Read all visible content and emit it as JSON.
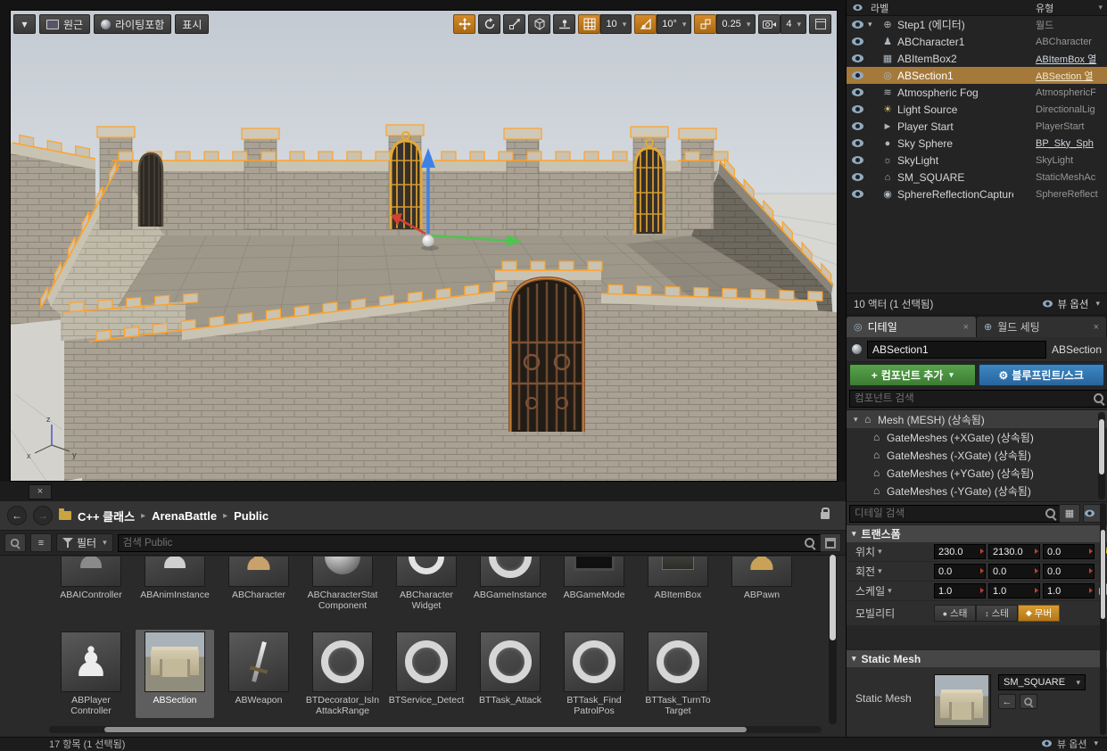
{
  "viewport": {
    "toolbar": {
      "options_arrow": "▾",
      "perspective": "원근",
      "lit": "라이팅포함",
      "show": "표시",
      "grid_snap_value": "10",
      "rotation_snap_value": "10°",
      "scale_snap_value": "0.25",
      "camera_speed_value": "4"
    },
    "axis_labels": {
      "x": "x",
      "y": "y",
      "z": "z"
    },
    "close_tab": "×"
  },
  "outliner": {
    "columns": {
      "label": "라벨",
      "type": "유형"
    },
    "rows": [
      {
        "icon": "world",
        "label": "Step1 (에디터)",
        "type": "월드",
        "expand": true
      },
      {
        "icon": "character",
        "label": "ABCharacter1",
        "type": "ABCharacter"
      },
      {
        "icon": "box",
        "label": "ABItemBox2",
        "type": "ABItemBox 열",
        "type_link": true
      },
      {
        "icon": "section",
        "label": "ABSection1",
        "type": "ABSection 열",
        "selected": true,
        "type_link": true
      },
      {
        "icon": "fog",
        "label": "Atmospheric Fog",
        "type": "AtmosphericF"
      },
      {
        "icon": "light",
        "label": "Light Source",
        "type": "DirectionalLig"
      },
      {
        "icon": "player",
        "label": "Player Start",
        "type": "PlayerStart"
      },
      {
        "icon": "sphere",
        "label": "Sky Sphere",
        "type": "BP_Sky_Sph",
        "type_link": true
      },
      {
        "icon": "skylight",
        "label": "SkyLight",
        "type": "SkyLight"
      },
      {
        "icon": "house",
        "label": "SM_SQUARE",
        "type": "StaticMeshAc"
      },
      {
        "icon": "capture",
        "label": "SphereReflectionCapture",
        "type": "SphereReflect"
      }
    ],
    "footer": {
      "status": "10 액터 (1 선택됨)",
      "view_options": "뷰 옵션"
    }
  },
  "details": {
    "tabs": [
      {
        "label": "디테일",
        "close": "×"
      },
      {
        "label": "월드 세팅",
        "close": "×"
      }
    ],
    "name_value": "ABSection1",
    "class_name": "ABSection",
    "add_component_label": "컴포넌트 추가",
    "blueprint_label": "블루프린트/스크",
    "component_search_placeholder": "컴포넌트 검색",
    "components": [
      {
        "label": "Mesh (MESH) (상속됨)",
        "hdr": true
      },
      {
        "label": "GateMeshes (+XGate) (상속됨)"
      },
      {
        "label": "GateMeshes (-XGate) (상속됨)"
      },
      {
        "label": "GateMeshes (+YGate) (상속됨)"
      },
      {
        "label": "GateMeshes (-YGate) (상속됨)"
      }
    ],
    "search_placeholder": "디테일 검색",
    "transform": {
      "title": "트랜스폼",
      "rows": [
        {
          "label": "위치",
          "values": [
            "230.0",
            "2130.0",
            "0.0"
          ],
          "reset": true
        },
        {
          "label": "회전",
          "values": [
            "0.0",
            "0.0",
            "0.0"
          ]
        },
        {
          "label": "스케일",
          "values": [
            "1.0",
            "1.0",
            "1.0"
          ],
          "lock": true
        }
      ],
      "mobility_label": "모빌리티",
      "mobility_options": [
        {
          "label": "스태"
        },
        {
          "label": "스테"
        },
        {
          "label": "무버",
          "active": true
        }
      ]
    },
    "static_mesh": {
      "title": "Static Mesh",
      "property_label": "Static Mesh",
      "value": "SM_SQUARE"
    }
  },
  "content_browser": {
    "breadcrumb": [
      "C++ 클래스",
      "ArenaBattle",
      "Public"
    ],
    "filter_label": "필터",
    "search_placeholder": "검색 Public",
    "assets_row1": [
      {
        "label": "ABAIController",
        "kind": "ctrl"
      },
      {
        "label": "ABAnimInstance",
        "kind": "anim"
      },
      {
        "label": "ABCharacter",
        "kind": "char"
      },
      {
        "label": "ABCharacterStat Component",
        "kind": "sphere"
      },
      {
        "label": "ABCharacter Widget",
        "kind": "widget"
      },
      {
        "label": "ABGameInstance",
        "kind": "ring"
      },
      {
        "label": "ABGameMode",
        "kind": "monitor"
      },
      {
        "label": "ABItemBox",
        "kind": "box"
      },
      {
        "label": "ABPawn",
        "kind": "gold"
      }
    ],
    "assets_row2": [
      {
        "label": "ABPlayer Controller",
        "kind": "pawnw"
      },
      {
        "label": "ABSection",
        "kind": "castle",
        "selected": true
      },
      {
        "label": "ABWeapon",
        "kind": "sword"
      },
      {
        "label": "BTDecorator_IsIn AttackRange",
        "kind": "ring"
      },
      {
        "label": "BTService_Detect",
        "kind": "ring"
      },
      {
        "label": "BTTask_Attack",
        "kind": "ring"
      },
      {
        "label": "BTTask_Find PatrolPos",
        "kind": "ring"
      },
      {
        "label": "BTTask_TurnTo Target",
        "kind": "ring"
      }
    ]
  },
  "bottom_bar": {
    "status": "17 항목 (1 선택됨)",
    "view_options": "뷰 옵션"
  }
}
